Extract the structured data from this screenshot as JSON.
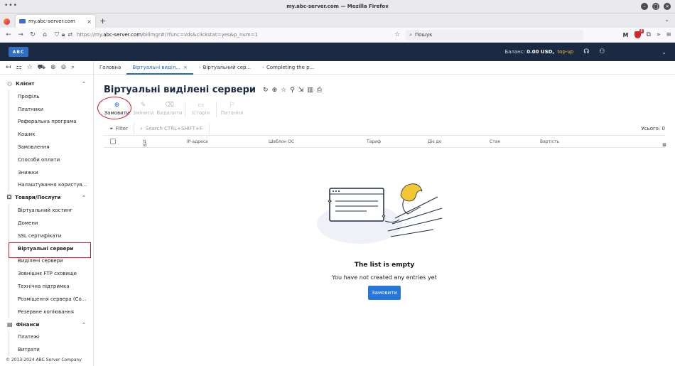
{
  "browser": {
    "window_title": "my.abc-server.com — Mozilla Firefox",
    "tab_title": "my.abc-server.com",
    "url_prefix": "https://my.",
    "url_host": "abc-server.com",
    "url_rest": "/billmgr#/?func=vds&clickstat=yes&p_num=1",
    "search_placeholder": "Пошук",
    "shield_badge": "8"
  },
  "header": {
    "logo": "ABC",
    "balance_label": "Баланс:",
    "balance_amount": "0.00 USD,",
    "topup": "top-up"
  },
  "breadcrumbs": [
    {
      "label": "Головна"
    },
    {
      "label": "Віртуальні виділ..."
    },
    {
      "label": "Віртуальний сер..."
    },
    {
      "label": "Completing the p..."
    }
  ],
  "sidebar": {
    "groups": [
      {
        "label": "Клієнт",
        "items": [
          "Профіль",
          "Платники",
          "Реферальна програма",
          "Кошик",
          "Замовлення",
          "Способи оплати",
          "Знижки",
          "Налаштування користув..."
        ]
      },
      {
        "label": "Товари/Послуги",
        "items": [
          "Віртуальний хостинг",
          "Домени",
          "SSL сертифікати",
          "Віртуальні сервери",
          "Виділені сервери",
          "Зовнішнє FTP сховище",
          "Технічна підтримка",
          "Розміщення сервера (Co...",
          "Резервне копіювання"
        ]
      },
      {
        "label": "Фінанси",
        "items": [
          "Платежі",
          "Витрати"
        ]
      }
    ],
    "selected_item": "Віртуальні сервери",
    "copyright": "© 2013-2024 ABC Server Company"
  },
  "page": {
    "title": "Віртуальні виділені сервери",
    "actions": [
      {
        "label": "Замовити",
        "icon": "plus-circle-icon",
        "enabled": true
      },
      {
        "label": "Змінити",
        "icon": "edit-icon",
        "enabled": false
      },
      {
        "label": "Видалити",
        "icon": "trash-icon",
        "enabled": false
      },
      {
        "label": "Історія",
        "icon": "history-icon",
        "enabled": false
      },
      {
        "label": "Питання",
        "icon": "question-icon",
        "enabled": false
      }
    ],
    "filter_label": "Filter",
    "search_placeholder": "Search CTRL+SHIFT+F",
    "total": "Усього: 0",
    "columns": [
      "Id",
      "IP-адреса",
      "Шаблон ОС",
      "Тариф",
      "Дiє до",
      "Стан",
      "Вартість"
    ],
    "empty_title": "The list is empty",
    "empty_subtitle": "You have not created any entries yet",
    "order_button": "Замовити"
  },
  "colors": {
    "header_bg": "#1c2942",
    "accent": "#2467c9",
    "topup": "#f3c633",
    "highlight": "#d01b28"
  }
}
